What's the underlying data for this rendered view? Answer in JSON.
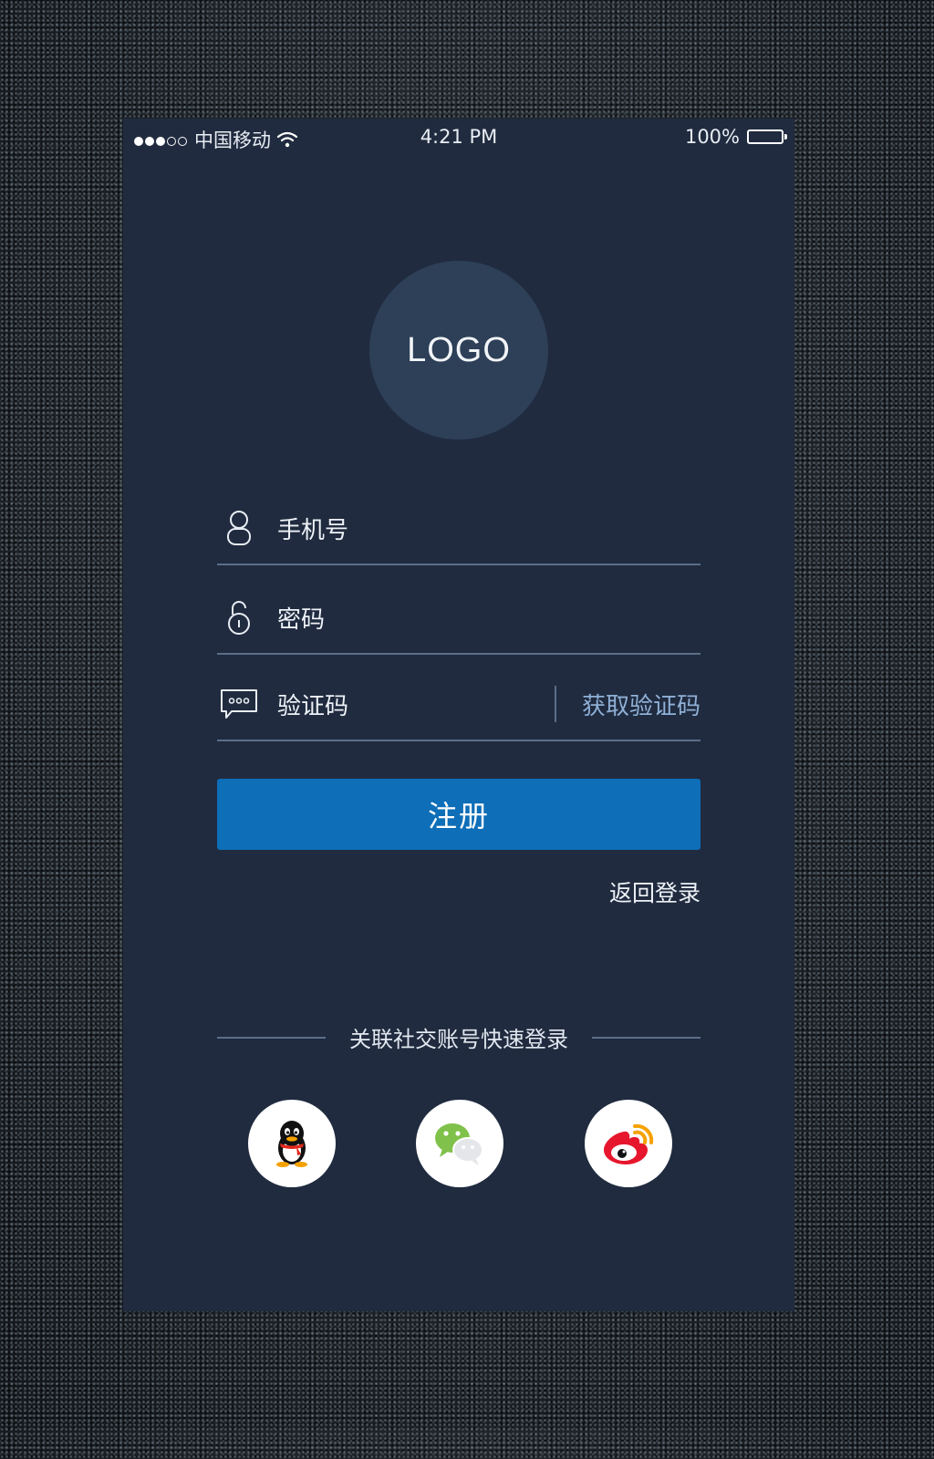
{
  "status_bar": {
    "carrier": "中国移动",
    "time": "4:21 PM",
    "battery_percent": "100%",
    "signal_bars_filled": 3,
    "signal_bars_total": 5
  },
  "logo": {
    "text": "LOGO"
  },
  "form": {
    "phone_placeholder": "手机号",
    "password_placeholder": "密码",
    "code_placeholder": "验证码",
    "get_code_label": "获取验证码"
  },
  "register_button": "注册",
  "back_to_login": "返回登录",
  "social": {
    "heading": "关联社交账号快速登录",
    "items": [
      {
        "icon": "qq-icon"
      },
      {
        "icon": "wechat-icon"
      },
      {
        "icon": "weibo-icon"
      }
    ]
  },
  "colors": {
    "background": "#202b3f",
    "accent": "#0e6eb8",
    "link": "#8fb0d6",
    "logo_circle": "#2e4058"
  }
}
